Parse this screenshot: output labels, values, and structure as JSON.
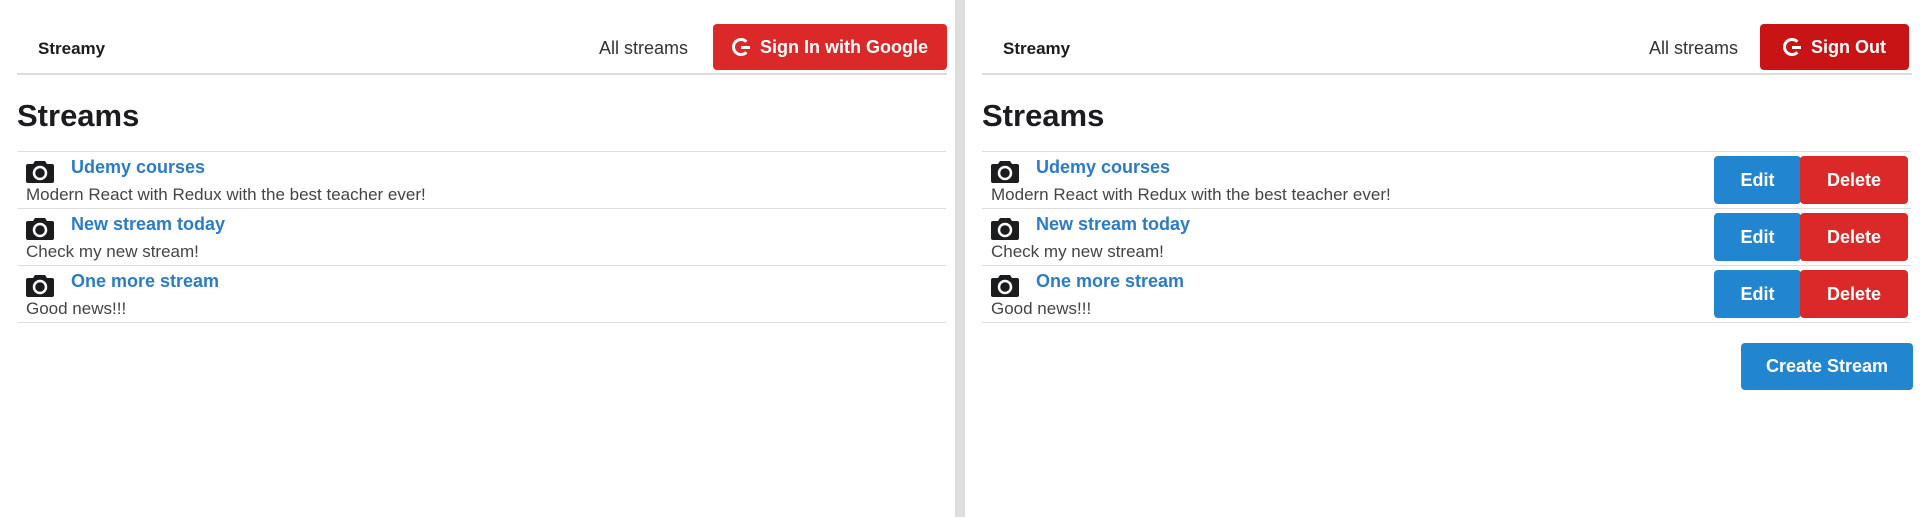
{
  "left": {
    "brand": "Streamy",
    "all_streams": "All streams",
    "auth_button": "Sign In with Google",
    "heading": "Streams",
    "streams": [
      {
        "title": "Udemy courses",
        "description": "Modern React with Redux with the best teacher ever!"
      },
      {
        "title": "New stream today",
        "description": "Check my new stream!"
      },
      {
        "title": "One more stream",
        "description": "Good news!!!"
      }
    ]
  },
  "right": {
    "brand": "Streamy",
    "all_streams": "All streams",
    "auth_button": "Sign Out",
    "heading": "Streams",
    "streams": [
      {
        "title": "Udemy courses",
        "description": "Modern React with Redux with the best teacher ever!",
        "edit": "Edit",
        "delete": "Delete"
      },
      {
        "title": "New stream today",
        "description": "Check my new stream!",
        "edit": "Edit",
        "delete": "Delete"
      },
      {
        "title": "One more stream",
        "description": "Good news!!!",
        "edit": "Edit",
        "delete": "Delete"
      }
    ],
    "create_button": "Create Stream"
  },
  "icons": {
    "stream_icon": "camera-icon",
    "auth_icon": "google-icon"
  },
  "colors": {
    "link": "#2b7cc7",
    "primary": "#2185d0",
    "danger": "#db2828",
    "signout": "#c81414"
  }
}
